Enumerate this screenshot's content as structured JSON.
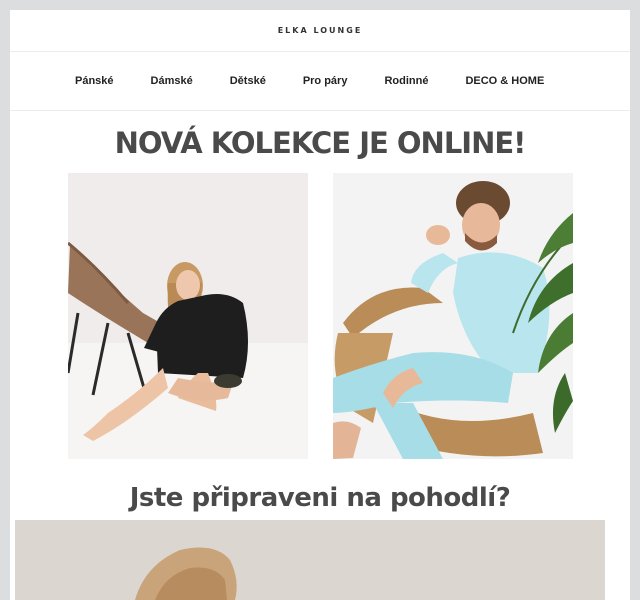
{
  "header": {
    "brand": "ELKA LOUNGE"
  },
  "nav": {
    "items": [
      {
        "label": "Pánské"
      },
      {
        "label": "Dámské"
      },
      {
        "label": "Dětské"
      },
      {
        "label": "Pro páry"
      },
      {
        "label": "Rodinné"
      },
      {
        "label": "DECO & HOME"
      }
    ]
  },
  "main": {
    "headline": "NOVÁ KOLEKCE JE ONLINE!",
    "subheadline": "Jste připraveni na pohodlí?"
  },
  "colors": {
    "page_bg": "#dcdddf",
    "card_bg": "#ffffff",
    "heading": "#4a4a4a",
    "mint_loungewear": "#b9e6ee",
    "black_sweatshirt": "#1e1e1e"
  }
}
